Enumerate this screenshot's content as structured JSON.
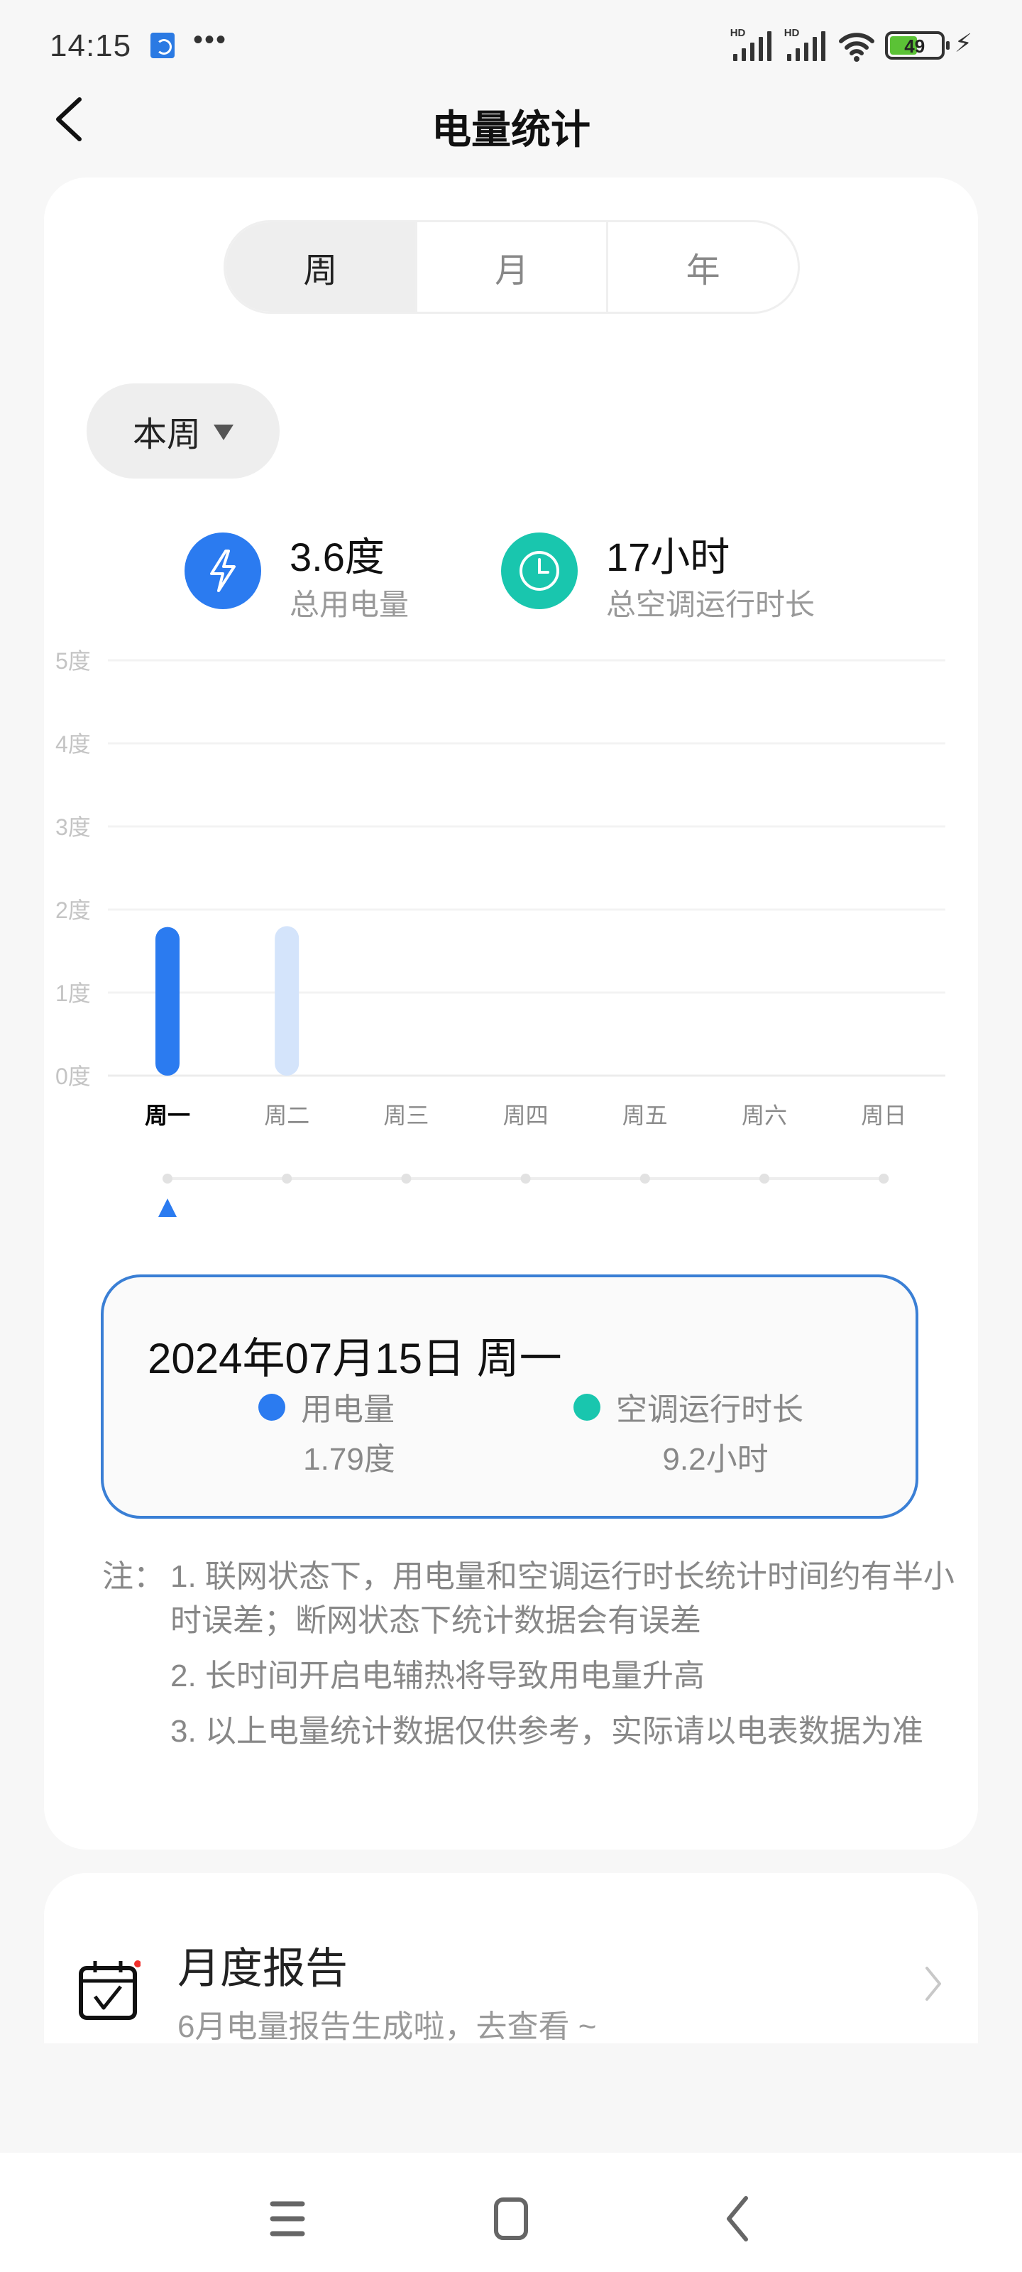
{
  "status_bar": {
    "time": "14:15",
    "app_icon": "app-notification-icon",
    "more": "•••",
    "signal_labels": [
      "HD",
      "HD"
    ],
    "battery_level": "49",
    "battery_color": "#5bc236"
  },
  "header": {
    "title": "电量统计",
    "back_icon": "chevron-left-icon"
  },
  "tabs": [
    {
      "label": "周",
      "active": true
    },
    {
      "label": "月",
      "active": false
    },
    {
      "label": "年",
      "active": false
    }
  ],
  "period_selector": {
    "label": "本周"
  },
  "summary": {
    "energy": {
      "value": "3.6度",
      "label": "总用电量",
      "icon": "lightning-icon",
      "color": "#2b7bf0"
    },
    "runtime": {
      "value": "17小时",
      "label": "总空调运行时长",
      "icon": "clock-icon",
      "color": "#19c6ae"
    }
  },
  "chart_data": {
    "type": "bar",
    "title": "",
    "xlabel": "",
    "ylabel": "",
    "categories": [
      "周一",
      "周二",
      "周三",
      "周四",
      "周五",
      "周六",
      "周日"
    ],
    "values": [
      1.79,
      1.8,
      null,
      null,
      null,
      null,
      null
    ],
    "y_ticks": [
      "0度",
      "1度",
      "2度",
      "3度",
      "4度",
      "5度"
    ],
    "ylim": [
      0,
      5
    ],
    "grid": true,
    "selected_index": 0,
    "colors": {
      "selected": "#2b7bf0",
      "unselected": "#d4e4fb"
    }
  },
  "detail": {
    "date": "2024年07月15日  周一",
    "energy_label": "用电量",
    "energy_value": "1.79度",
    "energy_color": "#2b7bf0",
    "runtime_label": "空调运行时长",
    "runtime_value": "9.2小时",
    "runtime_color": "#19c6ae",
    "border_color": "#3a7fd5"
  },
  "notes": {
    "prefix": "注：",
    "items": [
      "1. 联网状态下，用电量和空调运行时长统计时间约有半小时误差；断网状态下统计数据会有误差",
      "2. 长时间开启电辅热将导致用电量升高",
      "3. 以上电量统计数据仅供参考，实际请以电表数据为准"
    ]
  },
  "report": {
    "title": "月度报告",
    "subtitle": "6月电量报告生成啦，去查看 ~",
    "icon": "calendar-check-icon",
    "has_badge": true
  },
  "nav_bar": {
    "buttons": [
      "menu-icon",
      "home-icon",
      "back-icon"
    ]
  }
}
